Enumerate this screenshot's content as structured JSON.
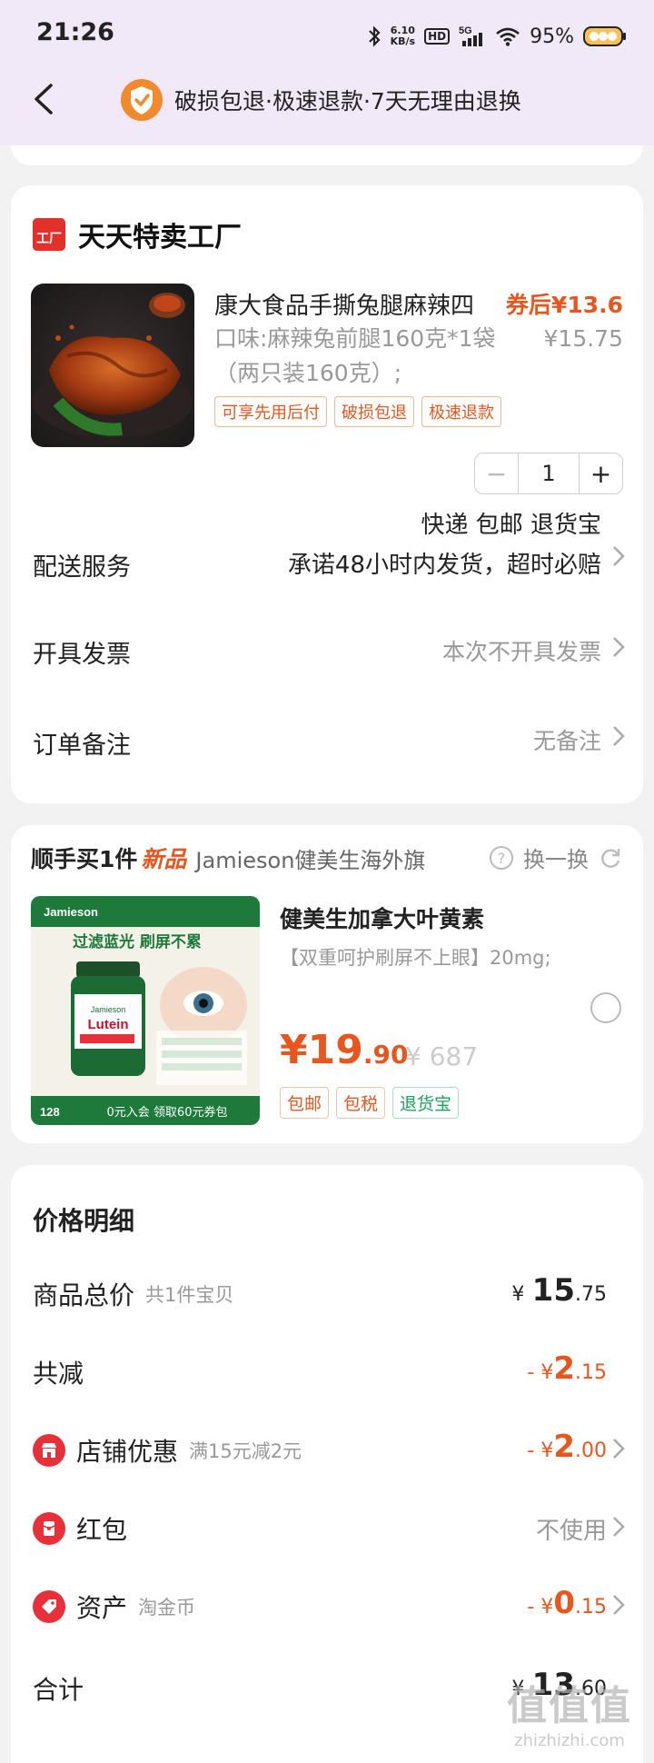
{
  "status_bar": {
    "time": "21:26",
    "speed_top": "6.10",
    "speed_bottom": "KB/s",
    "hd": "HD",
    "network": "5G",
    "battery": "95%"
  },
  "nav": {
    "guarantee_text": "破损包退·极速退款·7天无理由退换"
  },
  "store": {
    "name": "天天特卖工厂",
    "logo_text": "工厂",
    "product": {
      "title": "康大食品手撕兔腿麻辣四",
      "spec": "口味:麻辣兔前腿160克*1袋（两只装160克）;",
      "coupon_price": "券后¥13.6",
      "original_price": "¥15.75",
      "tags": [
        "可享先用后付",
        "破损包退",
        "极速退款"
      ],
      "quantity": "1",
      "minus": "−",
      "plus": "+"
    },
    "delivery": {
      "label": "配送服务",
      "line1": "快递 包邮 退货宝",
      "line2": "承诺48小时内发货，超时必赔"
    },
    "invoice": {
      "label": "开具发票",
      "value": "本次不开具发票"
    },
    "note": {
      "label": "订单备注",
      "value": "无备注"
    }
  },
  "recommend": {
    "title": "顺手买1件",
    "new_badge": "新品",
    "store": "Jamieson健美生海外旗",
    "swap_label": "换一换",
    "product_name": "健美生加拿大叶黄素",
    "description": "【双重呵护刷屏不上眼】20mg;",
    "price_int": "¥19",
    "price_dec": ".90",
    "original_price": "¥ 687",
    "tags": [
      {
        "text": "包邮",
        "color": "orange"
      },
      {
        "text": "包税",
        "color": "orange"
      },
      {
        "text": "退货宝",
        "color": "green"
      }
    ],
    "image_text": {
      "brand": "Jamieson",
      "headline": "过滤蓝光 刷屏不累",
      "product": "Lutein",
      "banner": "0元入会 领取60元券包",
      "count": "128"
    }
  },
  "price_detail": {
    "title": "价格明细",
    "total": {
      "label": "商品总价",
      "sub": "共1件宝贝",
      "currency": "¥",
      "int": "15",
      "dec": ".75"
    },
    "reduce": {
      "label": "共减",
      "prefix": "- ¥",
      "int": "2",
      "dec": ".15"
    },
    "shop_discount": {
      "label": "店铺优惠",
      "sub": "满15元减2元",
      "prefix": "- ¥",
      "int": "2",
      "dec": ".00"
    },
    "red_packet": {
      "label": "红包",
      "value": "不使用"
    },
    "assets": {
      "label": "资产",
      "sub": "淘金币",
      "prefix": "- ¥",
      "int": "0",
      "dec": ".15"
    },
    "sum": {
      "label": "合计",
      "currency": "¥",
      "int": "13",
      "dec": ".60"
    }
  },
  "watermark": {
    "big": "值值值",
    "small": "zhizhizhi.com"
  },
  "colors": {
    "accent": "#e8561e",
    "header_bg": "#f1e8f8",
    "red": "#e8303a",
    "green": "#1aa35c"
  }
}
